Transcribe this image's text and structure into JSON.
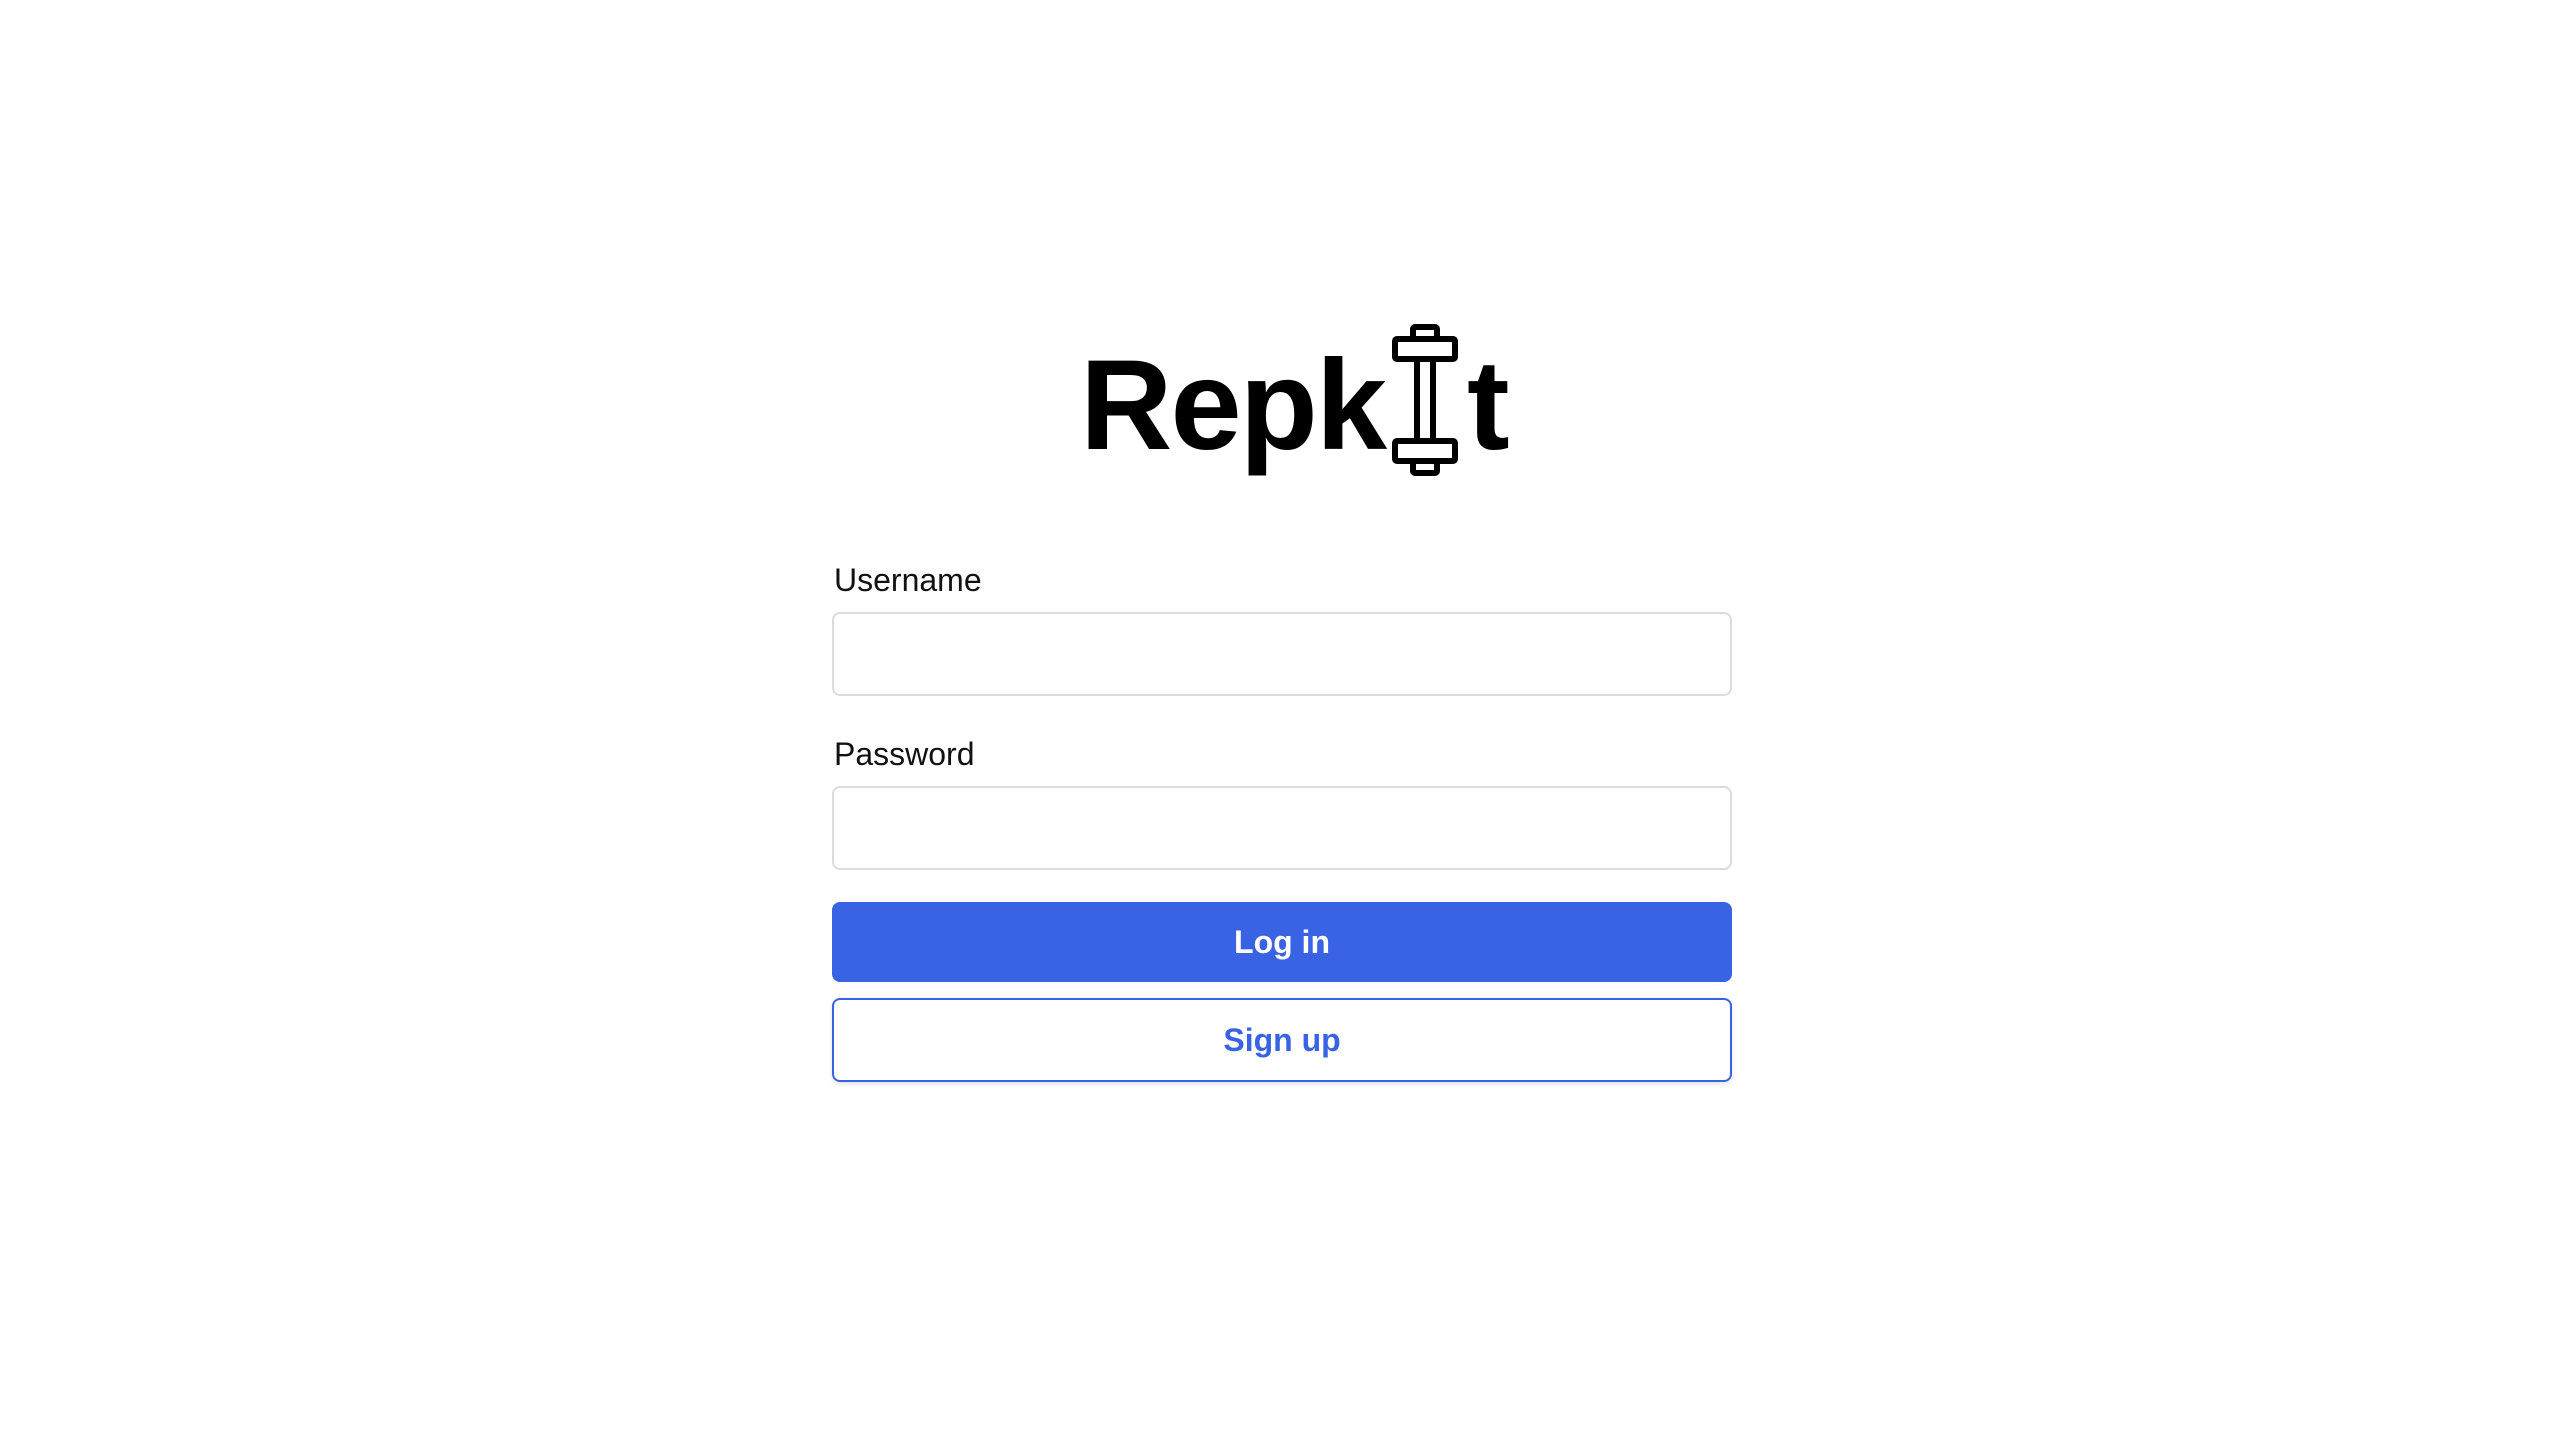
{
  "brand": {
    "logo_text_before": "Repk",
    "logo_text_after": "t",
    "logo_icon": "dumbbell-icon"
  },
  "form": {
    "username_label": "Username",
    "username_value": "",
    "password_label": "Password",
    "password_value": "",
    "login_label": "Log in",
    "signup_label": "Sign up"
  },
  "colors": {
    "accent": "#3a63e3",
    "text": "#111111",
    "background": "#ffffff",
    "input_border": "#dcdcdc"
  }
}
